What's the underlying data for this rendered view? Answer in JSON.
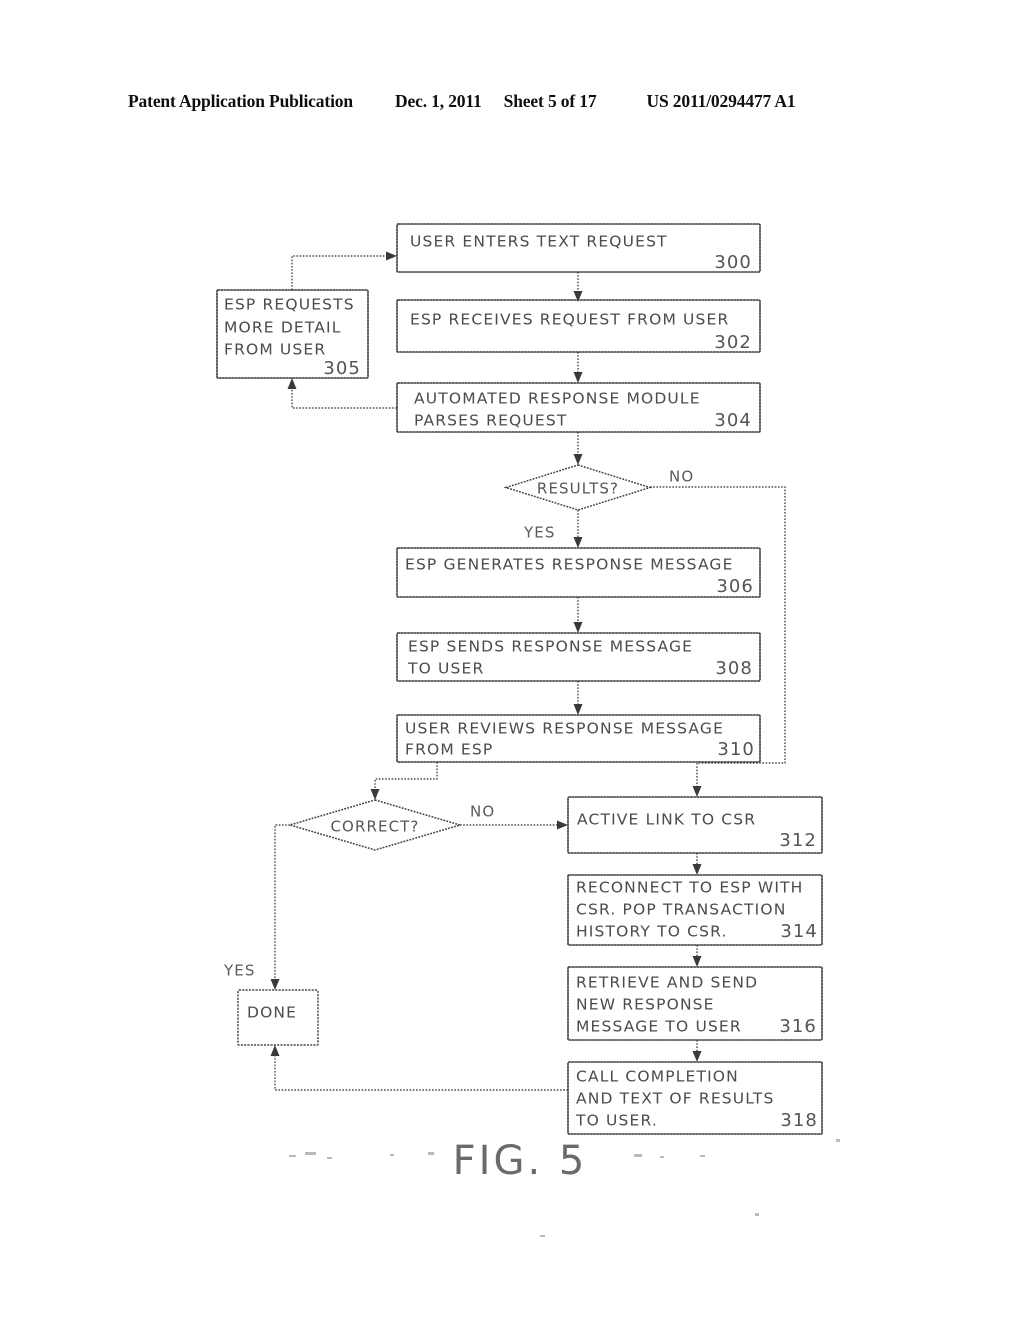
{
  "header": {
    "publication": "Patent Application Publication",
    "date": "Dec. 1, 2011",
    "sheet": "Sheet 5 of 17",
    "patent_number": "US 2011/0294477 A1"
  },
  "figure": {
    "caption": "FIG.  5",
    "nodes": [
      {
        "id": "300",
        "type": "process",
        "ref": "300",
        "lines": [
          "USER  ENTERS  TEXT  REQUEST"
        ]
      },
      {
        "id": "305",
        "type": "process",
        "ref": "305",
        "lines": [
          "ESP  REQUESTS",
          "MORE  DETAIL",
          "FROM  USER"
        ]
      },
      {
        "id": "302",
        "type": "process",
        "ref": "302",
        "lines": [
          "ESP  RECEIVES  REQUEST  FROM  USER"
        ]
      },
      {
        "id": "304",
        "type": "process",
        "ref": "304",
        "lines": [
          "AUTOMATED  RESPONSE  MODULE",
          "PARSES  REQUEST"
        ]
      },
      {
        "id": "results",
        "type": "decision",
        "label": "RESULTS?"
      },
      {
        "id": "306",
        "type": "process",
        "ref": "306",
        "lines": [
          "ESP  GENERATES  RESPONSE  MESSAGE"
        ]
      },
      {
        "id": "308",
        "type": "process",
        "ref": "308",
        "lines": [
          "ESP  SENDS  RESPONSE  MESSAGE",
          "TO  USER"
        ]
      },
      {
        "id": "310",
        "type": "process",
        "ref": "310",
        "lines": [
          "USER  REVIEWS  RESPONSE  MESSAGE",
          "FROM  ESP"
        ]
      },
      {
        "id": "correct",
        "type": "decision",
        "label": "CORRECT?"
      },
      {
        "id": "312",
        "type": "process",
        "ref": "312",
        "lines": [
          "ACTIVE  LINK  TO  CSR"
        ]
      },
      {
        "id": "314",
        "type": "process",
        "ref": "314",
        "lines": [
          "RECONNECT  TO  ESP  WITH",
          "CSR.   POP  TRANSACTION",
          "HISTORY  TO  CSR."
        ]
      },
      {
        "id": "316",
        "type": "process",
        "ref": "316",
        "lines": [
          "RETRIEVE  AND  SEND",
          "NEW  RESPONSE",
          "MESSAGE  TO  USER"
        ]
      },
      {
        "id": "318",
        "type": "process",
        "ref": "318",
        "lines": [
          "CALL  COMPLETION",
          "AND  TEXT  OF  RESULTS",
          "TO  USER."
        ]
      },
      {
        "id": "done",
        "type": "terminal",
        "lines": [
          "DONE"
        ]
      }
    ],
    "edge_labels": {
      "results_no": "NO",
      "results_yes": "YES",
      "correct_no": "NO",
      "correct_yes": "YES"
    }
  }
}
